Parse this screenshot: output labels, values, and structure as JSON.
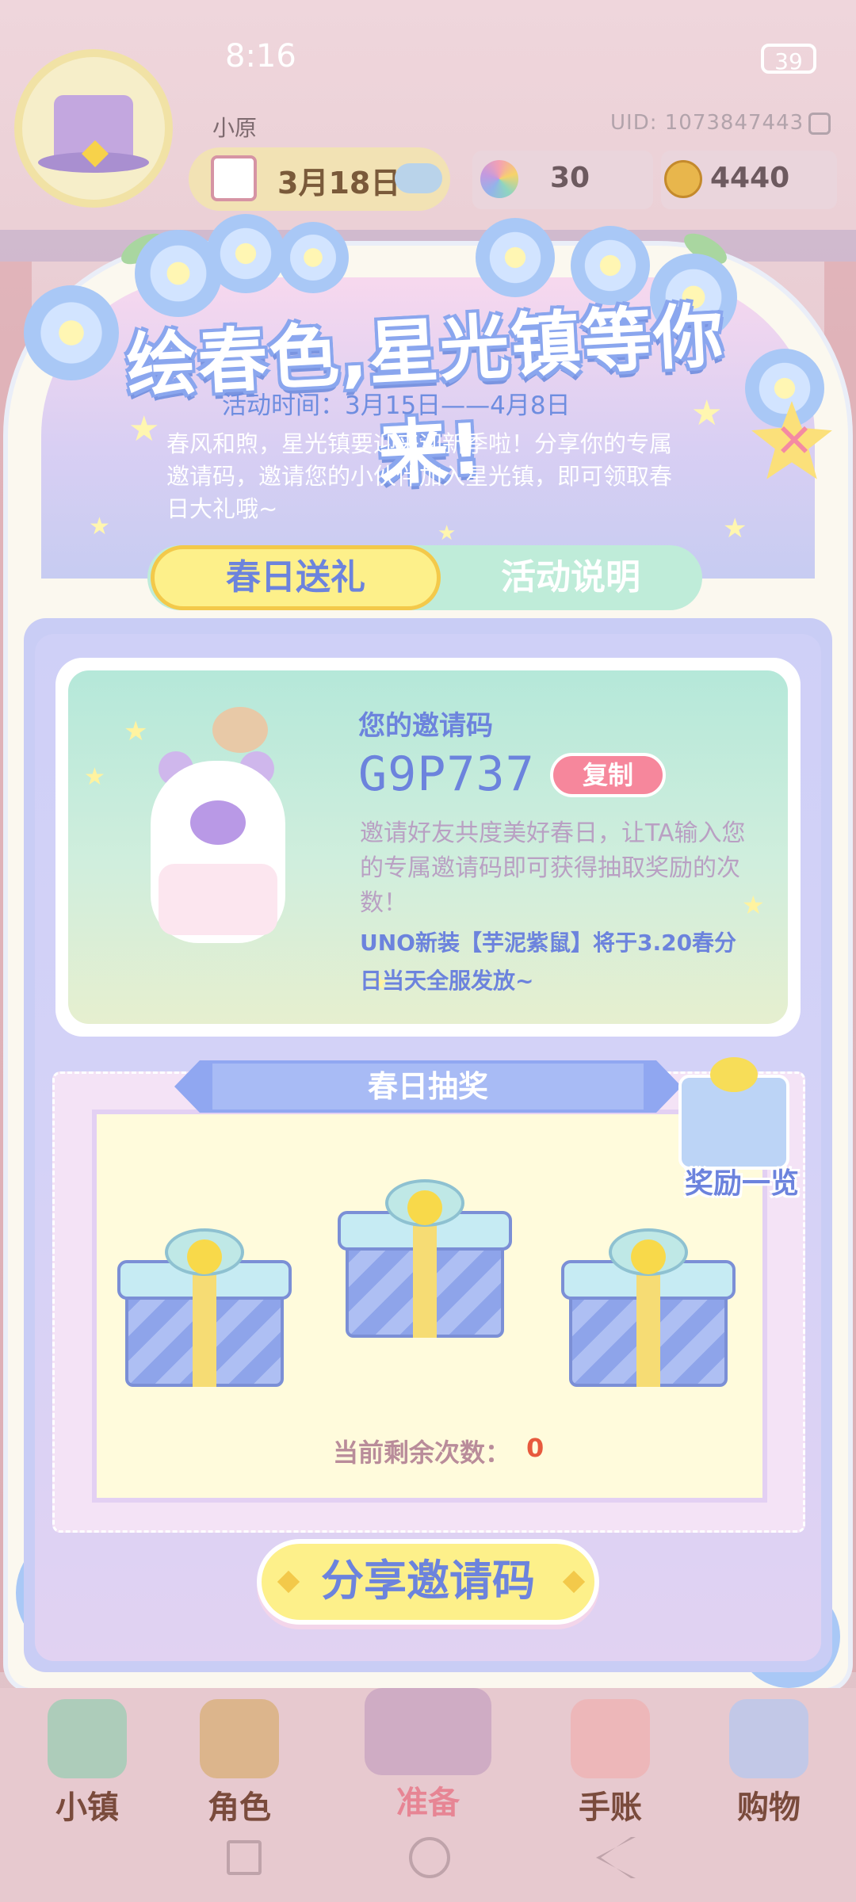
{
  "status_bar": {
    "time": "8:16",
    "battery": "39"
  },
  "header": {
    "username": "小原",
    "uid": "UID: 1073847443",
    "date": "3月18日",
    "gems": "30",
    "coins": "4440"
  },
  "popup": {
    "title": "绘春色,星光镇等你来!",
    "event_time": "活动时间：3月15日——4月8日",
    "description": "春风和煦，星光镇要迎来迎新季啦！分享你的专属邀请码，邀请您的小伙伴加入星光镇，即可领取春日大礼哦~",
    "tabs": [
      {
        "label": "春日送礼",
        "active": true
      },
      {
        "label": "活动说明",
        "active": false
      }
    ],
    "invite": {
      "label": "您的邀请码",
      "code": "G9P737",
      "copy_label": "复制",
      "description": "邀请好友共度美好春日，让TA输入您的专属邀请码即可获得抽取奖励的次数！",
      "note": "UNO新装【芋泥紫鼠】将于3.20春分日当天全服发放~"
    },
    "lottery": {
      "title": "春日抽奖",
      "rewards_label": "奖励一览",
      "remaining_label": "当前剩余次数：",
      "remaining_value": "0"
    },
    "share_label": "分享邀请码"
  },
  "bottom_nav": [
    {
      "label": "小镇",
      "icon": "map-icon"
    },
    {
      "label": "角色",
      "icon": "character-icon"
    },
    {
      "label": "准备",
      "icon": "prepare-icon"
    },
    {
      "label": "手账",
      "icon": "journal-icon"
    },
    {
      "label": "购物",
      "icon": "shopping-bag-icon"
    }
  ],
  "colors": {
    "accent": "#6c83dd",
    "close": "#f48aa3",
    "copy": "#f6879c",
    "remaining_value": "#e7593d"
  }
}
